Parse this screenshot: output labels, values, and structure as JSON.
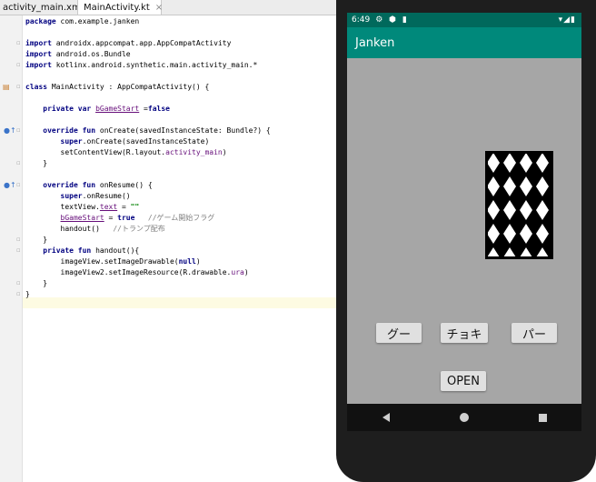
{
  "ide": {
    "tabs": [
      {
        "label": "activity_main.xml",
        "close": "×"
      },
      {
        "label": "MainActivity.kt",
        "close": "×"
      }
    ],
    "code": {
      "l1a": "package",
      "l1b": " com.example.janken",
      "l3a": "import",
      "l3b": " androidx.appcompat.app.AppCompatActivity",
      "l4a": "import",
      "l4b": " android.os.Bundle",
      "l5a": "import",
      "l5b": " kotlinx.android.synthetic.main.activity_main.*",
      "l7a": "class",
      "l7b": " MainActivity : AppCompatActivity() {",
      "l9a": "    private var ",
      "l9b": "bGameStart",
      "l9c": " =",
      "l9d": "false",
      "l11a": "    override fun",
      "l11b": " onCreate(savedInstanceState: Bundle?) {",
      "l12a": "        super",
      "l12b": ".onCreate(savedInstanceState)",
      "l13a": "        setContentView(R.layout.",
      "l13b": "activity_main",
      "l13c": ")",
      "l14": "    }",
      "l16a": "    override fun",
      "l16b": " onResume() {",
      "l17a": "        super",
      "l17b": ".onResume()",
      "l18a": "        textView.",
      "l18b": "text",
      "l18c": " = ",
      "l18d": "\"\"",
      "l19a": "        ",
      "l19b": "bGameStart",
      "l19c": " = ",
      "l19d": "true",
      "l19e": "   //ゲーム開始フラグ",
      "l20a": "        handout()   ",
      "l20b": "//トランプ配布",
      "l21": "    }",
      "l22a": "    private fun",
      "l22b": " handout(){",
      "l23a": "        imageView.setImageDrawable(",
      "l23b": "null",
      "l23c": ")",
      "l24a": "        imageView2.setImageResource(R.drawable.",
      "l24b": "ura",
      "l24c": ")",
      "l25": "    }",
      "l26": "}"
    }
  },
  "phone": {
    "status": {
      "time": "6:49",
      "left_icons": "⚙ ⬢ ▮",
      "right_icons": "▾◢▮"
    },
    "app_title": "Janken",
    "buttons": {
      "gu": "グー",
      "choki": "チョキ",
      "pa": "パー",
      "open": "OPEN"
    },
    "card_back_pattern": "lattice",
    "colors": {
      "statusbar": "#00695c",
      "appbar": "#00897b",
      "screen_bg": "#a6a6a6"
    }
  }
}
